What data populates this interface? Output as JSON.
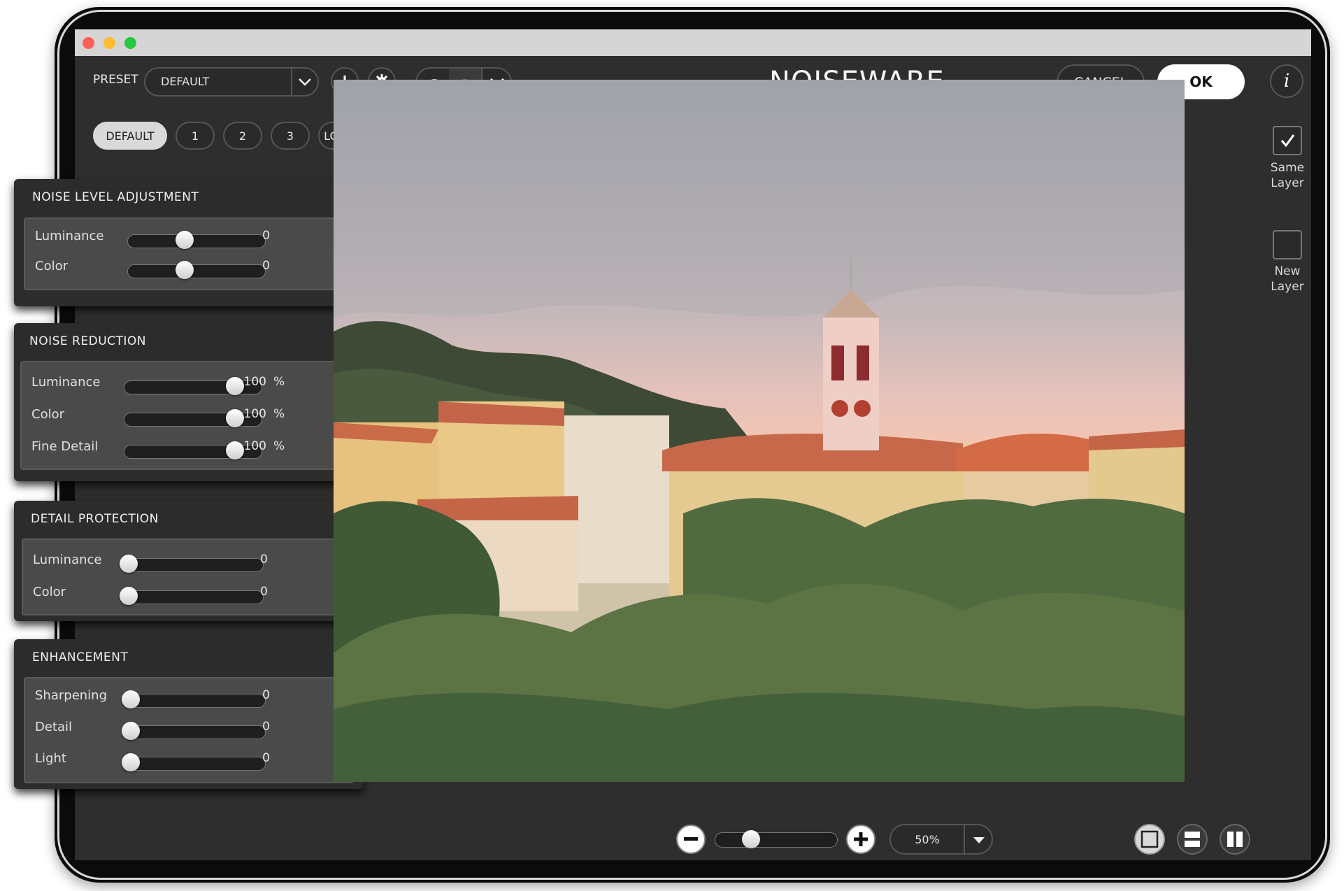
{
  "app": {
    "title": "NOISEWARE"
  },
  "toolbar": {
    "preset_label": "PRESET",
    "preset_value": "DEFAULT",
    "cancel_label": "CANCEL",
    "ok_label": "OK"
  },
  "preset_tabs": [
    "DEFAULT",
    "1",
    "2",
    "3",
    "LOW LIGHT"
  ],
  "panels": {
    "noise_level": {
      "title": "NOISE LEVEL ADJUSTMENT",
      "rows": [
        {
          "label": "Luminance",
          "value": "0",
          "unit": "",
          "fraction": 0.5
        },
        {
          "label": "Color",
          "value": "0",
          "unit": "",
          "fraction": 0.5
        }
      ]
    },
    "noise_reduction": {
      "title": "NOISE REDUCTION",
      "rows": [
        {
          "label": "Luminance",
          "value": "100",
          "unit": "%",
          "fraction": 1.0
        },
        {
          "label": "Color",
          "value": "100",
          "unit": "%",
          "fraction": 1.0
        },
        {
          "label": "Fine Detail",
          "value": "100",
          "unit": "%",
          "fraction": 1.0
        }
      ]
    },
    "detail_protection": {
      "title": "DETAIL PROTECTION",
      "rows": [
        {
          "label": "Luminance",
          "value": "0",
          "unit": "",
          "fraction": 0.0
        },
        {
          "label": "Color",
          "value": "0",
          "unit": "",
          "fraction": 0.0
        }
      ]
    },
    "enhancement": {
      "title": "ENHANCEMENT",
      "rows": [
        {
          "label": "Sharpening",
          "value": "0",
          "unit": "",
          "fraction": 0.0
        },
        {
          "label": "Detail",
          "value": "0",
          "unit": "",
          "fraction": 0.0
        },
        {
          "label": "Light",
          "value": "0",
          "unit": "",
          "fraction": 0.0
        }
      ]
    }
  },
  "layers": {
    "same_layer_line1": "Same",
    "same_layer_line2": "Layer",
    "same_layer_checked": true,
    "new_layer_line1": "New",
    "new_layer_line2": "Layer",
    "new_layer_checked": false
  },
  "zoom": {
    "value": "50%",
    "fraction": 0.25
  },
  "icons": {
    "add": "plus-icon",
    "settings": "gear-icon",
    "undo": "undo-icon",
    "redo": "redo-icon",
    "history": "chevron-down-icon",
    "info": "info-icon",
    "zoom_out": "minus-icon",
    "zoom_in": "plus-icon",
    "view_single": "single-view-icon",
    "view_split_h": "split-horizontal-icon",
    "view_split_v": "split-vertical-icon"
  }
}
